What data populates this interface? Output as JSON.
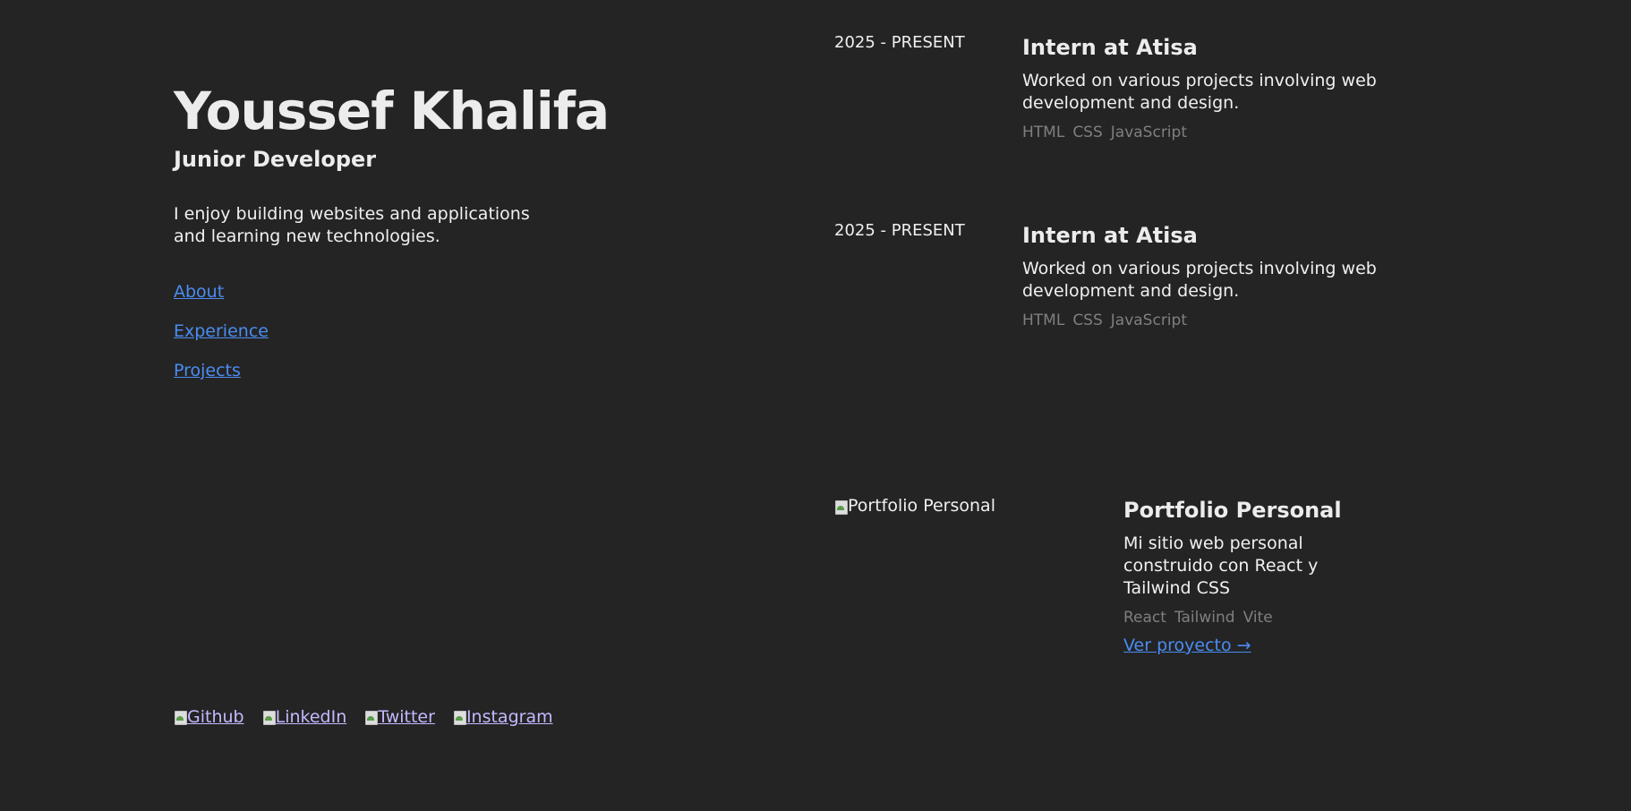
{
  "profile": {
    "name": "Youssef Khalifa",
    "role": "Junior Developer",
    "intro": "I enjoy building websites and applications and learning new technologies."
  },
  "nav": {
    "items": [
      {
        "label": "About"
      },
      {
        "label": "Experience"
      },
      {
        "label": "Projects"
      }
    ]
  },
  "socials": {
    "items": [
      {
        "label": "Github"
      },
      {
        "label": "LinkedIn"
      },
      {
        "label": "Twitter"
      },
      {
        "label": "Instagram"
      }
    ]
  },
  "experience": {
    "items": [
      {
        "date": "2025 - PRESENT",
        "title": "Intern at Atisa",
        "description": "Worked on various projects involving web development and design.",
        "tags": [
          "HTML",
          "CSS",
          "JavaScript"
        ]
      },
      {
        "date": "2025 - PRESENT",
        "title": "Intern at Atisa",
        "description": "Worked on various projects involving web development and design.",
        "tags": [
          "HTML",
          "CSS",
          "JavaScript"
        ]
      }
    ]
  },
  "projects": {
    "items": [
      {
        "image_alt": "Portfolio Personal",
        "title": "Portfolio Personal",
        "description": "Mi sitio web personal construido con React y Tailwind CSS",
        "tags": [
          "React",
          "Tailwind",
          "Vite"
        ],
        "link_label": "Ver proyecto →"
      }
    ]
  },
  "colors": {
    "background": "#242424",
    "link": "#4b8cf2",
    "social_link": "#c6b8ff",
    "tag": "#7f7f7f"
  }
}
